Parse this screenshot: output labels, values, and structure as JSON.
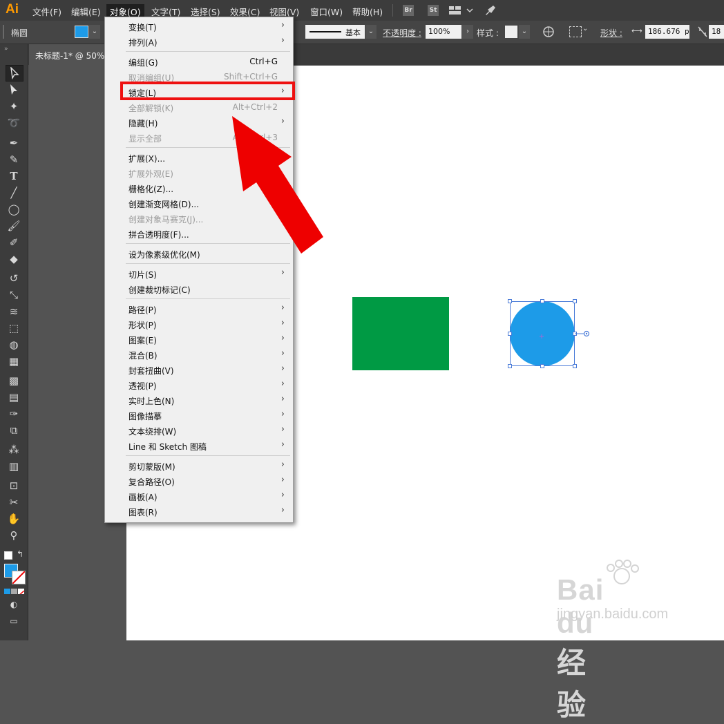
{
  "app": {
    "logo": "Ai",
    "menubar": [
      "文件(F)",
      "编辑(E)",
      "对象(O)",
      "文字(T)",
      "选择(S)",
      "效果(C)",
      "视图(V)",
      "窗口(W)",
      "帮助(H)"
    ],
    "bridge_badges": [
      "Br",
      "St"
    ]
  },
  "control_bar": {
    "shape_name": "椭圆",
    "fill_color": "#1d9be8",
    "stroke_style_label": "基本",
    "opacity_label": "不透明度 :",
    "opacity_value": "100%",
    "style_label": "样式 :",
    "shape_label": "形状 :",
    "width_value": "186.676 p",
    "height_value": "18"
  },
  "document": {
    "tab_title": "未标题-1* @ 50%"
  },
  "menu": {
    "groups": [
      [
        {
          "label": "变换(T)",
          "shortcut": "",
          "submenu": true,
          "enabled": true
        },
        {
          "label": "排列(A)",
          "shortcut": "",
          "submenu": true,
          "enabled": true
        }
      ],
      [
        {
          "label": "编组(G)",
          "shortcut": "Ctrl+G",
          "submenu": false,
          "enabled": true
        },
        {
          "label": "取消编组(U)",
          "shortcut": "Shift+Ctrl+G",
          "submenu": false,
          "enabled": false
        },
        {
          "label": "锁定(L)",
          "shortcut": "",
          "submenu": true,
          "enabled": true
        },
        {
          "label": "全部解锁(K)",
          "shortcut": "Alt+Ctrl+2",
          "submenu": false,
          "enabled": false
        },
        {
          "label": "隐藏(H)",
          "shortcut": "",
          "submenu": true,
          "enabled": true
        },
        {
          "label": "显示全部",
          "shortcut": "Alt+Ctrl+3",
          "submenu": false,
          "enabled": false
        }
      ],
      [
        {
          "label": "扩展(X)...",
          "shortcut": "",
          "submenu": false,
          "enabled": true
        },
        {
          "label": "扩展外观(E)",
          "shortcut": "",
          "submenu": false,
          "enabled": false
        },
        {
          "label": "栅格化(Z)...",
          "shortcut": "",
          "submenu": false,
          "enabled": true
        },
        {
          "label": "创建渐变网格(D)...",
          "shortcut": "",
          "submenu": false,
          "enabled": true
        },
        {
          "label": "创建对象马赛克(J)...",
          "shortcut": "",
          "submenu": false,
          "enabled": false
        },
        {
          "label": "拼合透明度(F)...",
          "shortcut": "",
          "submenu": false,
          "enabled": true
        }
      ],
      [
        {
          "label": "设为像素级优化(M)",
          "shortcut": "",
          "submenu": false,
          "enabled": true
        }
      ],
      [
        {
          "label": "切片(S)",
          "shortcut": "",
          "submenu": true,
          "enabled": true
        },
        {
          "label": "创建裁切标记(C)",
          "shortcut": "",
          "submenu": false,
          "enabled": true
        }
      ],
      [
        {
          "label": "路径(P)",
          "shortcut": "",
          "submenu": true,
          "enabled": true
        },
        {
          "label": "形状(P)",
          "shortcut": "",
          "submenu": true,
          "enabled": true
        },
        {
          "label": "图案(E)",
          "shortcut": "",
          "submenu": true,
          "enabled": true
        },
        {
          "label": "混合(B)",
          "shortcut": "",
          "submenu": true,
          "enabled": true
        },
        {
          "label": "封套扭曲(V)",
          "shortcut": "",
          "submenu": true,
          "enabled": true
        },
        {
          "label": "透视(P)",
          "shortcut": "",
          "submenu": true,
          "enabled": true
        },
        {
          "label": "实时上色(N)",
          "shortcut": "",
          "submenu": true,
          "enabled": true
        },
        {
          "label": "图像描摹",
          "shortcut": "",
          "submenu": true,
          "enabled": true
        },
        {
          "label": "文本绕排(W)",
          "shortcut": "",
          "submenu": true,
          "enabled": true
        },
        {
          "label": "Line 和 Sketch 图稿",
          "shortcut": "",
          "submenu": true,
          "enabled": true
        }
      ],
      [
        {
          "label": "剪切蒙版(M)",
          "shortcut": "",
          "submenu": true,
          "enabled": true
        },
        {
          "label": "复合路径(O)",
          "shortcut": "",
          "submenu": true,
          "enabled": true
        },
        {
          "label": "画板(A)",
          "shortcut": "",
          "submenu": true,
          "enabled": true
        },
        {
          "label": "图表(R)",
          "shortcut": "",
          "submenu": true,
          "enabled": true
        }
      ]
    ]
  },
  "canvas": {
    "rect_color": "#009a44",
    "circle_color": "#1d9be8"
  },
  "watermark": {
    "line1": "Bai du 经验",
    "line2": "jingyan.baidu.com"
  },
  "colors": {
    "highlight_frame": "#ee1111",
    "arrow": "#ee0000"
  }
}
